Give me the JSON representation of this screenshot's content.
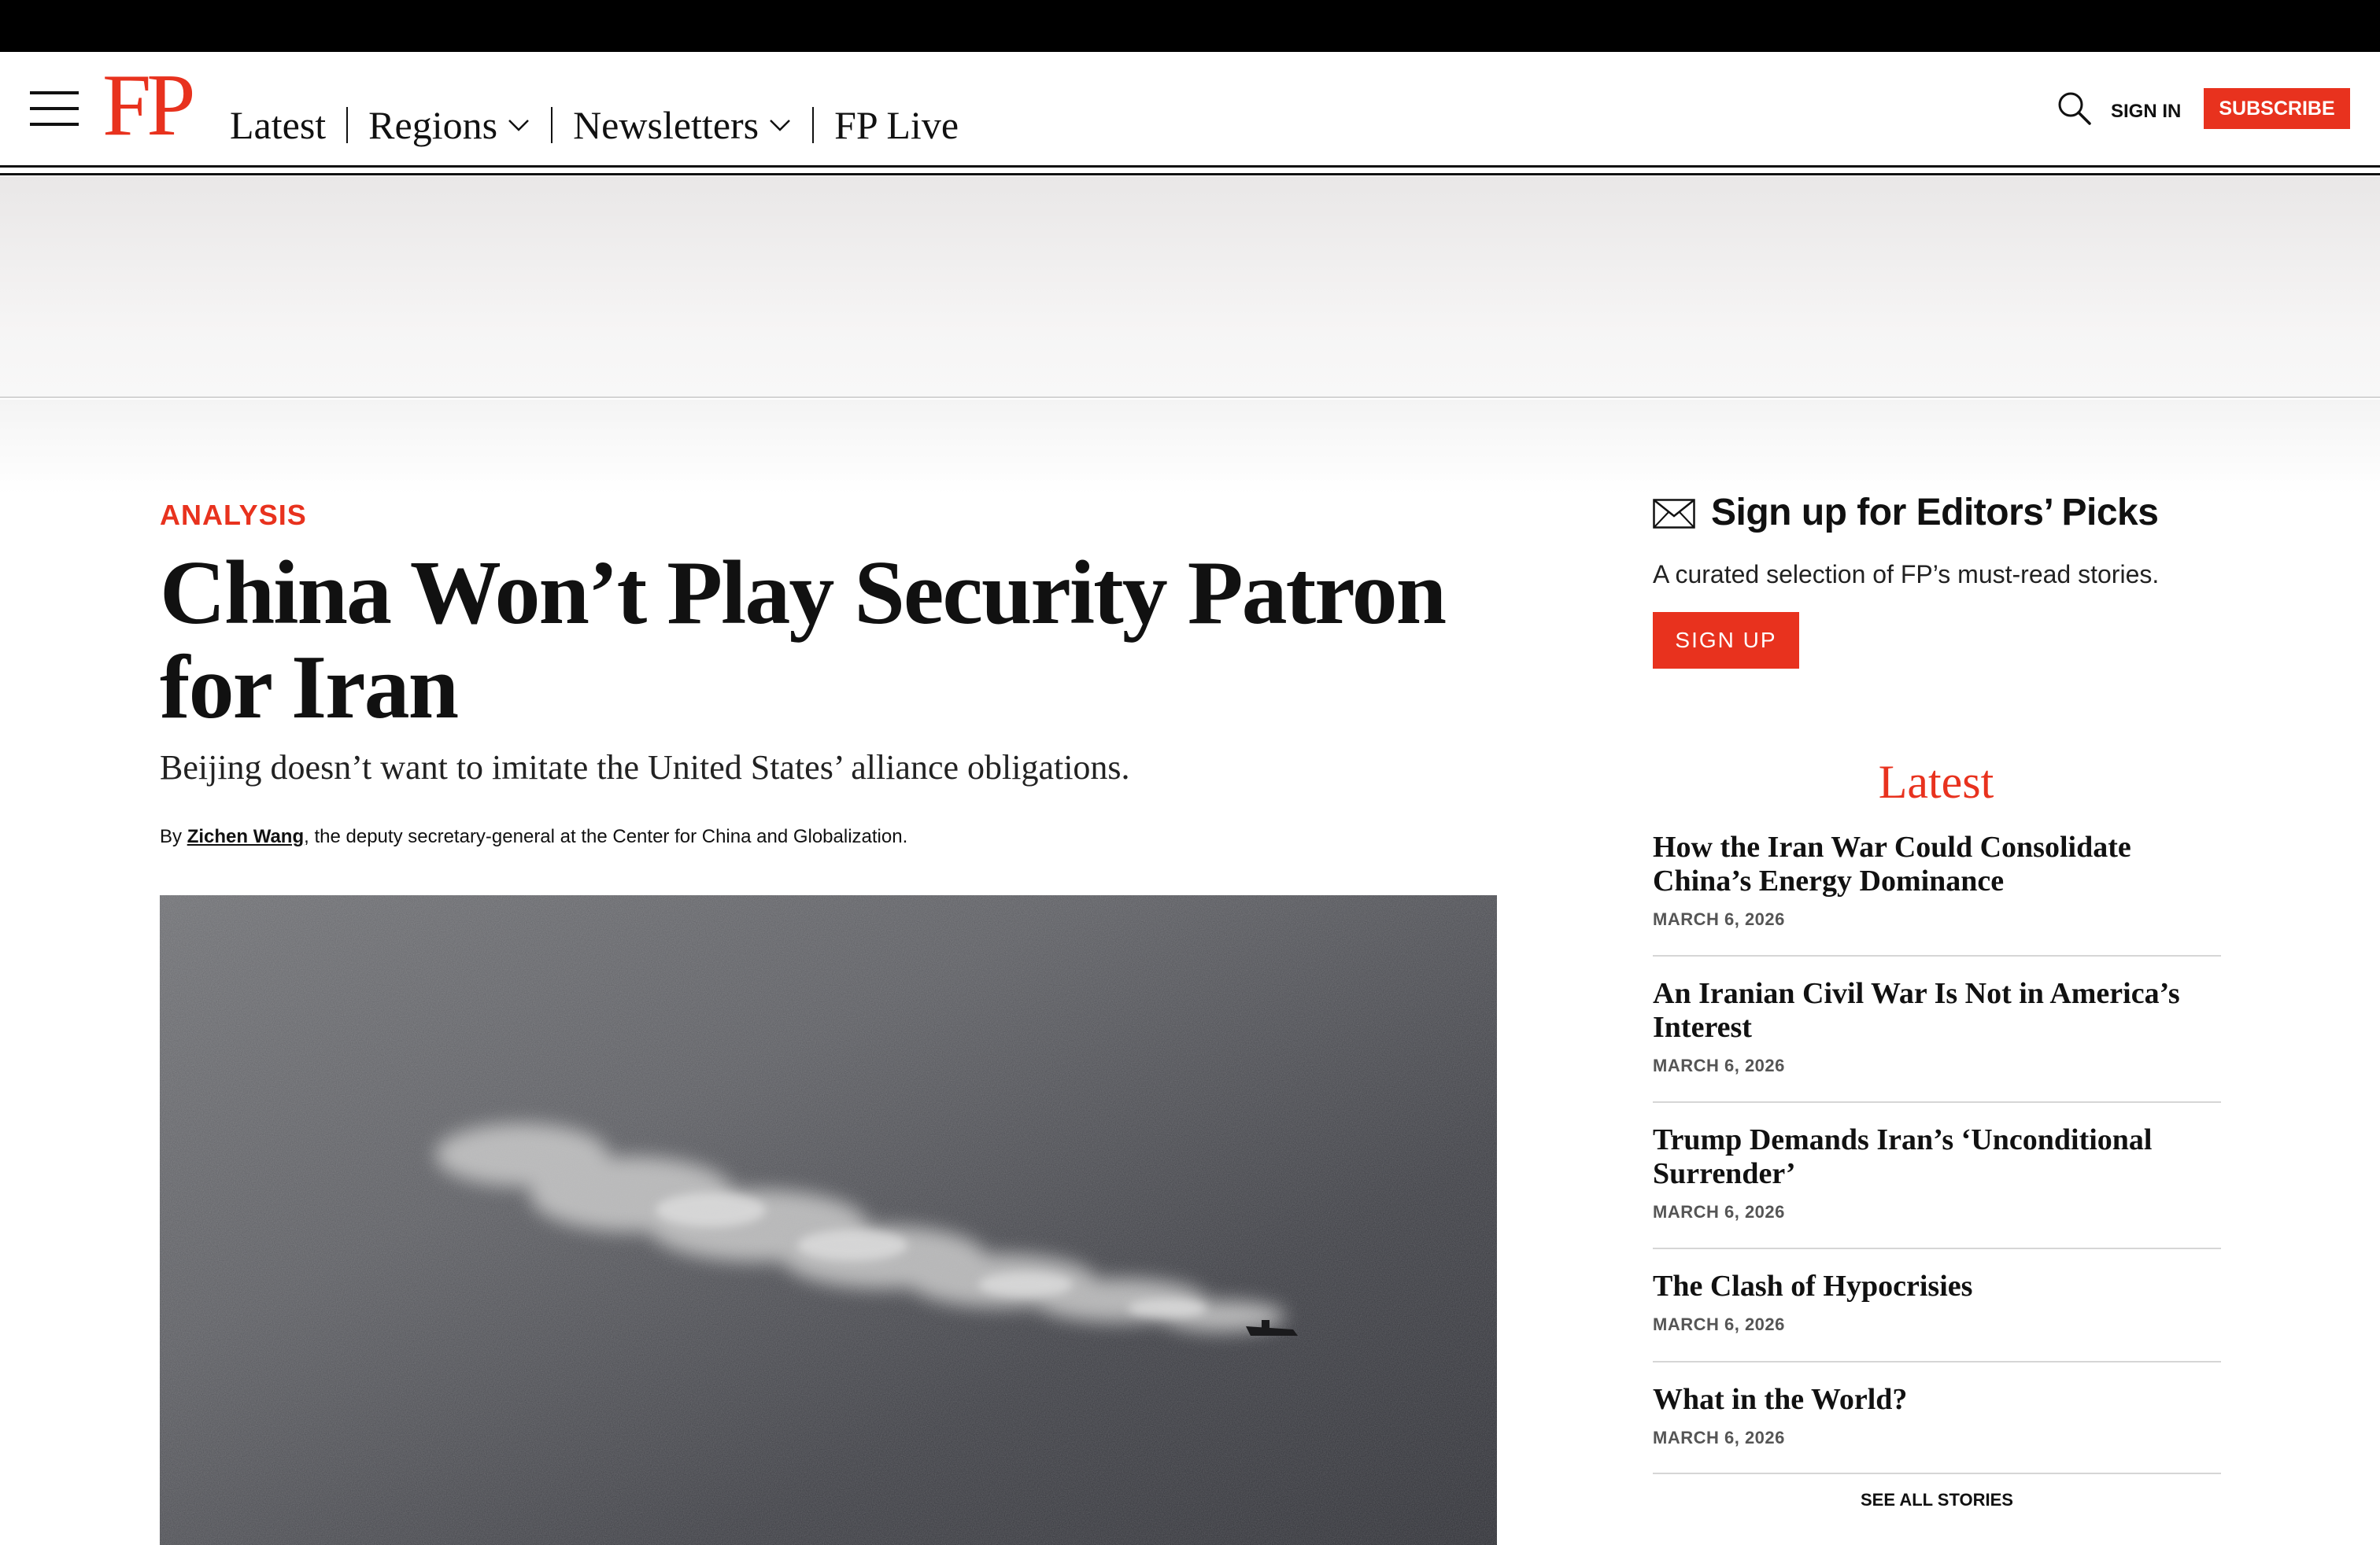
{
  "header": {
    "logo": "FP",
    "nav": [
      {
        "label": "Latest",
        "dropdown": false
      },
      {
        "label": "Regions",
        "dropdown": true
      },
      {
        "label": "Newsletters",
        "dropdown": true
      },
      {
        "label": "FP Live",
        "dropdown": false
      }
    ],
    "sign_in": "SIGN IN",
    "subscribe": "SUBSCRIBE"
  },
  "article": {
    "kicker": "ANALYSIS",
    "headline": "China Won’t Play Security Patron for Iran",
    "dek": "Beijing doesn’t want to imitate the United States’ alliance obligations.",
    "byline_prefix": "By ",
    "author": "Zichen Wang",
    "author_desc": ", the deputy secretary-general at the Center for China and Globalization."
  },
  "sidebar": {
    "signup_title": "Sign up for Editors’ Picks",
    "signup_desc": "A curated selection of FP’s must-read stories.",
    "signup_button": "SIGN UP",
    "latest_heading": "Latest",
    "latest": [
      {
        "title": "How the Iran War Could Consolidate China’s Energy Dominance",
        "date": "MARCH 6, 2026"
      },
      {
        "title": "An Iranian Civil War Is Not in America’s Interest",
        "date": "MARCH 6, 2026"
      },
      {
        "title": "Trump Demands Iran’s ‘Unconditional Surrender’",
        "date": "MARCH 6, 2026"
      },
      {
        "title": "The Clash of Hypocrisies",
        "date": "MARCH 6, 2026"
      },
      {
        "title": "What in the World?",
        "date": "MARCH 6, 2026"
      }
    ],
    "see_all": "SEE ALL STORIES"
  },
  "colors": {
    "brand_red": "#e8321e",
    "text": "#111111"
  },
  "icons": [
    "hamburger-menu-icon",
    "search-icon",
    "chevron-down-icon",
    "envelope-icon"
  ]
}
